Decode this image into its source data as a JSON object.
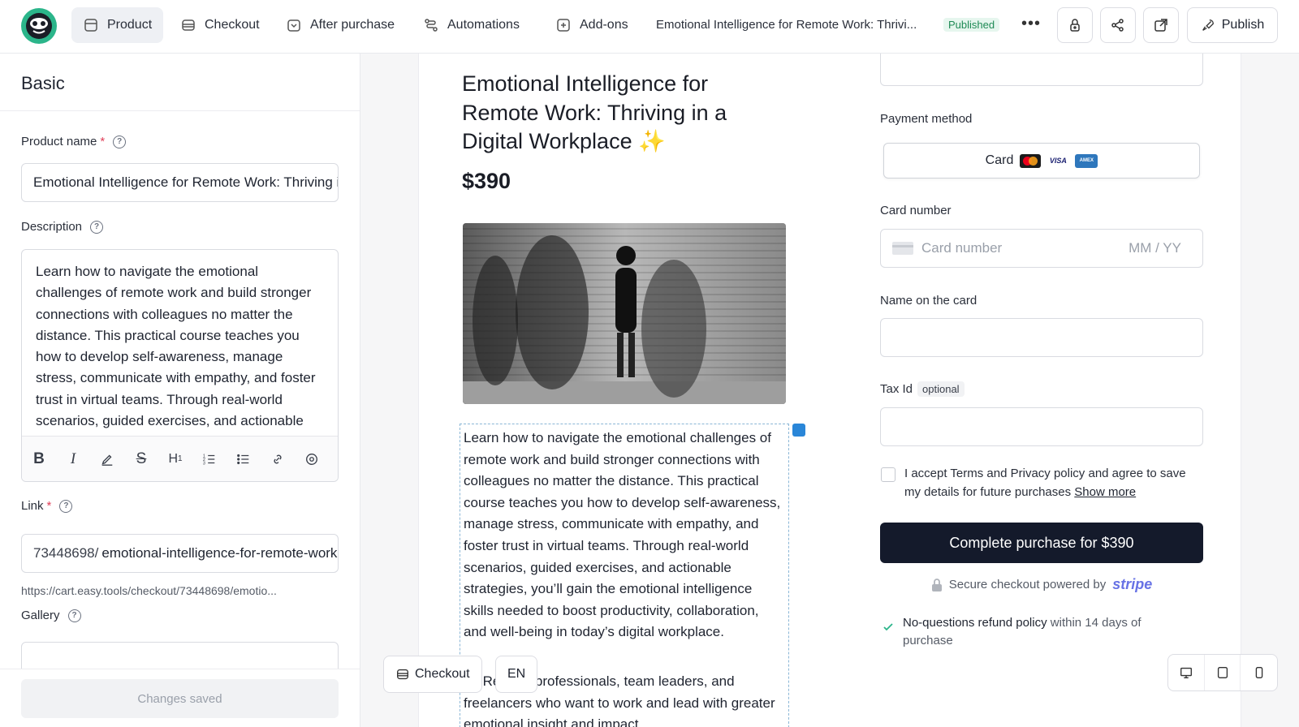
{
  "nav": {
    "items": [
      {
        "label": "Product",
        "icon": "product-icon",
        "active": true
      },
      {
        "label": "Checkout",
        "icon": "checkout-icon"
      },
      {
        "label": "After purchase",
        "icon": "after-purchase-icon"
      },
      {
        "label": "Automations",
        "icon": "automations-icon"
      },
      {
        "label": "Add-ons",
        "icon": "add-ons-icon"
      }
    ],
    "doc_title": "Emotional Intelligence for Remote Work: Thrivi...",
    "status": "Published",
    "more": "•••",
    "publish_label": "Publish"
  },
  "left": {
    "section_title": "Basic",
    "product_name_label": "Product name",
    "product_name_value": "Emotional Intelligence for Remote Work: Thriving in a Digital Workplace",
    "description_label": "Description",
    "description_value": "Learn how to navigate the emotional challenges of remote work and build stronger connections with colleagues no matter the distance. This practical course teaches you how to develop self-awareness, manage stress, communicate with empathy, and foster trust in virtual teams. Through real-world scenarios, guided exercises, and actionable strategies",
    "link_label": "Link",
    "link_prefix": "73448698/",
    "link_slug": "emotional-intelligence-for-remote-work",
    "link_url": "https://cart.easy.tools/checkout/73448698/emotio...",
    "gallery_label": "Gallery",
    "saved_label": "Changes saved",
    "required_mark": "*",
    "help_mark": "?"
  },
  "preview": {
    "title": "Emotional Intelligence for Remote Work: Thriving in a Digital Workplace ✨",
    "price": "$390",
    "description": "Learn how to navigate the emotional challenges of remote work and build stronger connections with colleagues no matter the distance. This practical course teaches you how to develop self-awareness, manage stress, communicate with empathy, and foster trust in virtual teams. Through real-world scenarios, guided exercises, and actionable strategies, you’ll gain the emotional intelligence skills needed to boost productivity, collaboration, and well-being in today’s digital workplace.",
    "who_prefix": "fo",
    "who_text": ": Remote professionals, team leaders, and freelancers who want to work and lead with greater emotional insight and impact."
  },
  "checkout": {
    "payment_method_label": "Payment method",
    "card_label": "Card",
    "visa_label": "VISA",
    "amex_label": "AMEX",
    "card_number_label": "Card number",
    "card_number_placeholder": "Card number",
    "expiry_placeholder": "MM / YY",
    "name_label": "Name on the card",
    "tax_label": "Tax Id",
    "tax_optional": "optional",
    "terms_text": "I accept Terms and Privacy policy and agree to save my details for future purchases ",
    "show_more": "Show more",
    "complete_label": "Complete purchase for $390",
    "secure_text": "Secure checkout powered by",
    "stripe": "stripe",
    "refund_bold": "No-questions refund policy",
    "refund_rest": " within 14 days of purchase"
  },
  "floating": {
    "checkout_pill": "Checkout",
    "lang_pill": "EN"
  }
}
